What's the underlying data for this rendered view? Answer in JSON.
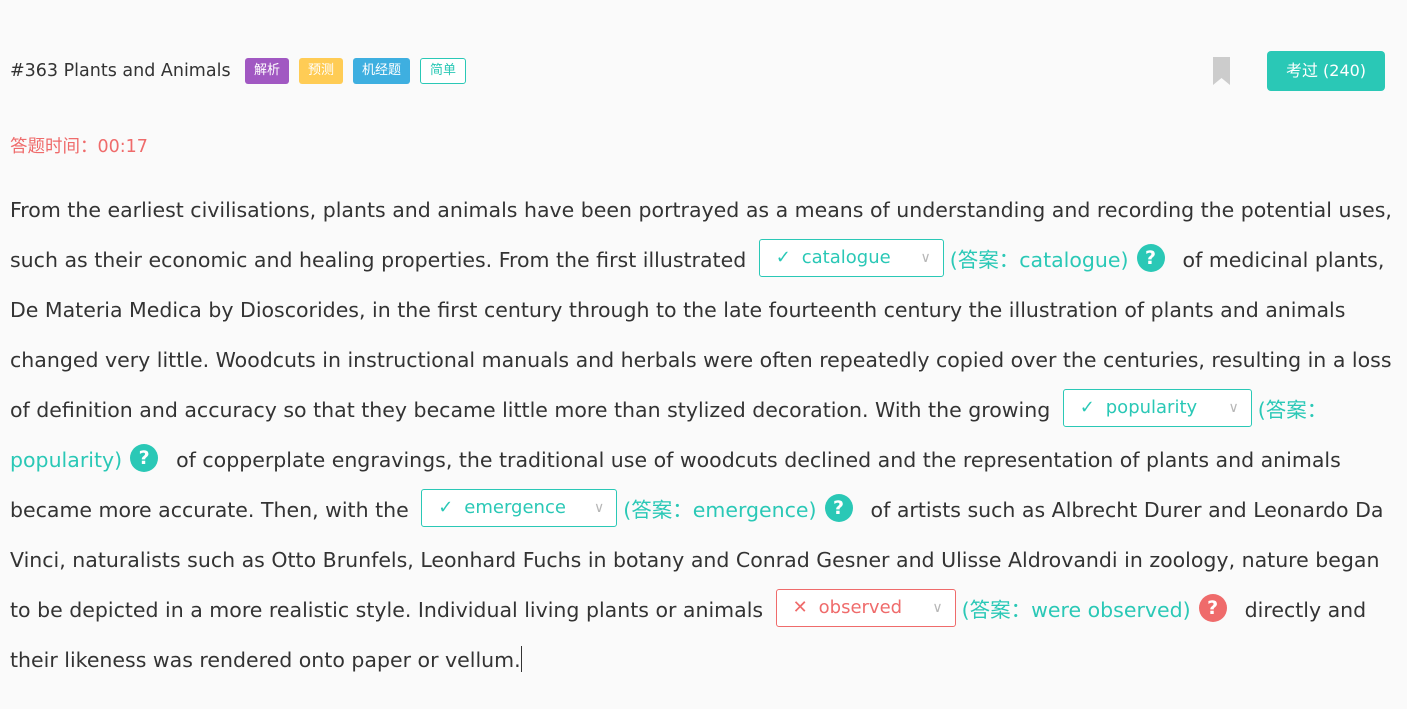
{
  "header": {
    "title": "#363 Plants and Animals",
    "tags": [
      "解析",
      "预测",
      "机经题",
      "简单"
    ],
    "exam_button": "考过 (240)"
  },
  "timer": {
    "label": "答题时间：",
    "value": "00:17"
  },
  "passage": {
    "seg1": "From the earliest civilisations, plants and animals have been portrayed as a means of understanding and recording the potential uses, such as their economic and healing properties. From the first illustrated",
    "blank1": {
      "mark": "✓",
      "value": "catalogue",
      "answer": "(答案：catalogue)",
      "status": "correct"
    },
    "seg2": "of medicinal plants, De Materia Medica by Dioscorides, in the first century through to the late fourteenth century the illustration of plants and animals changed very little. Woodcuts in instructional manuals and herbals were often repeatedly copied over the centuries, resulting in a loss of definition and accuracy so that they became little more than stylized decoration. With the growing",
    "blank2": {
      "mark": "✓",
      "value": "popularity",
      "answer": "(答案：popularity)",
      "status": "correct"
    },
    "seg3": "of copperplate engravings, the traditional use of woodcuts declined and the representation of plants and animals became more accurate. Then, with the",
    "blank3": {
      "mark": "✓",
      "value": "emergence",
      "answer": "(答案：emergence)",
      "status": "correct"
    },
    "seg4": "of artists such as Albrecht Durer and Leonardo Da Vinci, naturalists such as Otto Brunfels, Leonhard Fuchs in botany and Conrad Gesner and Ulisse Aldrovandi in zoology, nature began to be depicted in a more realistic style. Individual living plants or animals",
    "blank4": {
      "mark": "✕",
      "value": "observed",
      "answer": "(答案：were observed)",
      "status": "wrong"
    },
    "seg5": "directly and their likeness was rendered onto paper or vellum."
  },
  "icons": {
    "help": "?",
    "chevron": "∨"
  },
  "colors": {
    "accent": "#2ac8b6",
    "error": "#ef6b6b",
    "tag_purple": "#a158c2",
    "tag_yellow": "#ffcc55",
    "tag_blue": "#3eafe0"
  }
}
